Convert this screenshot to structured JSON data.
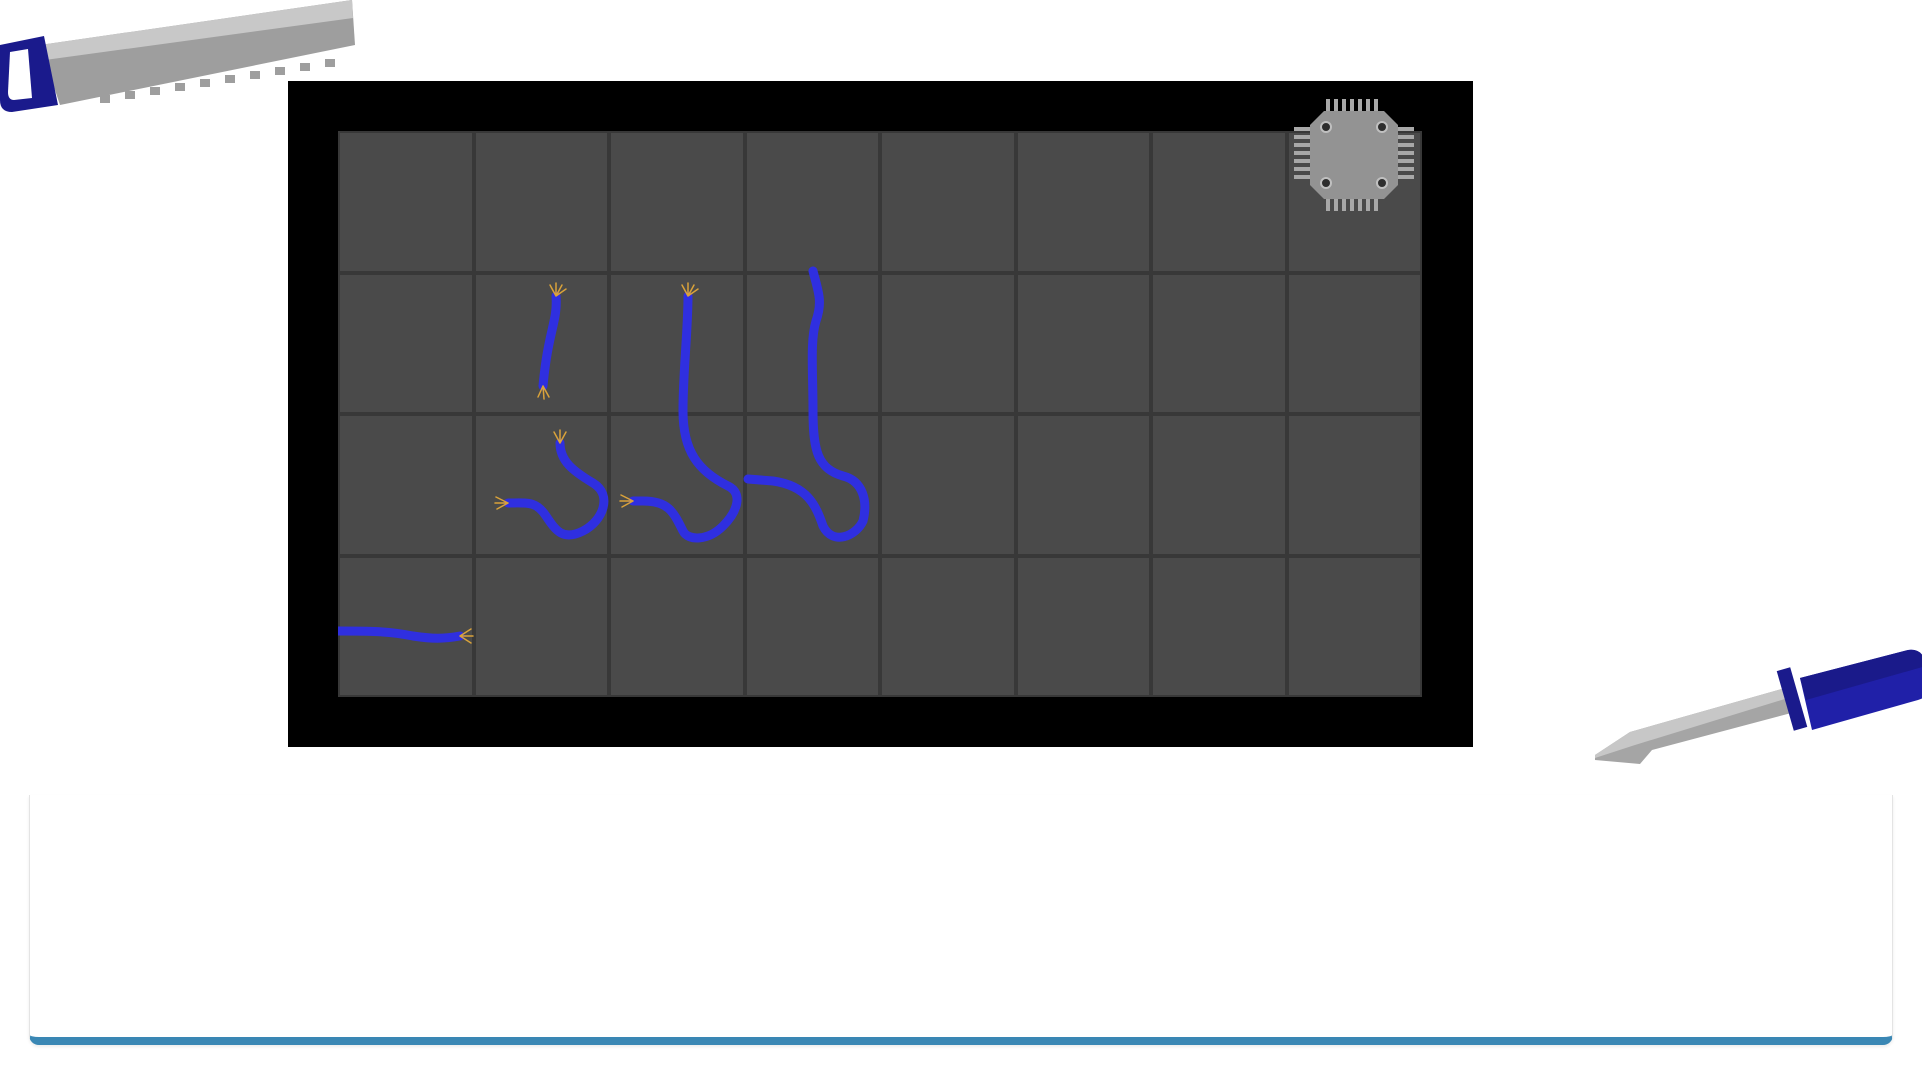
{
  "game": {
    "grid": {
      "columns": 8,
      "rows": 4
    },
    "tools": [
      {
        "name": "saw",
        "icon": "saw-icon"
      },
      {
        "name": "screwdriver",
        "icon": "screwdriver-icon"
      }
    ],
    "chip": {
      "icon": "microchip-icon",
      "cell": [
        8,
        1
      ]
    },
    "colors": {
      "frame": "#000000",
      "cell": "#4a4a4a",
      "grid_line": "#383838",
      "wire": "#2f2fe0",
      "wire_strands": "#d9a23a",
      "tool_handle": "#1e1e9a",
      "tool_metal": "#9a9a9a",
      "panel_border": "#3a87b4"
    }
  }
}
